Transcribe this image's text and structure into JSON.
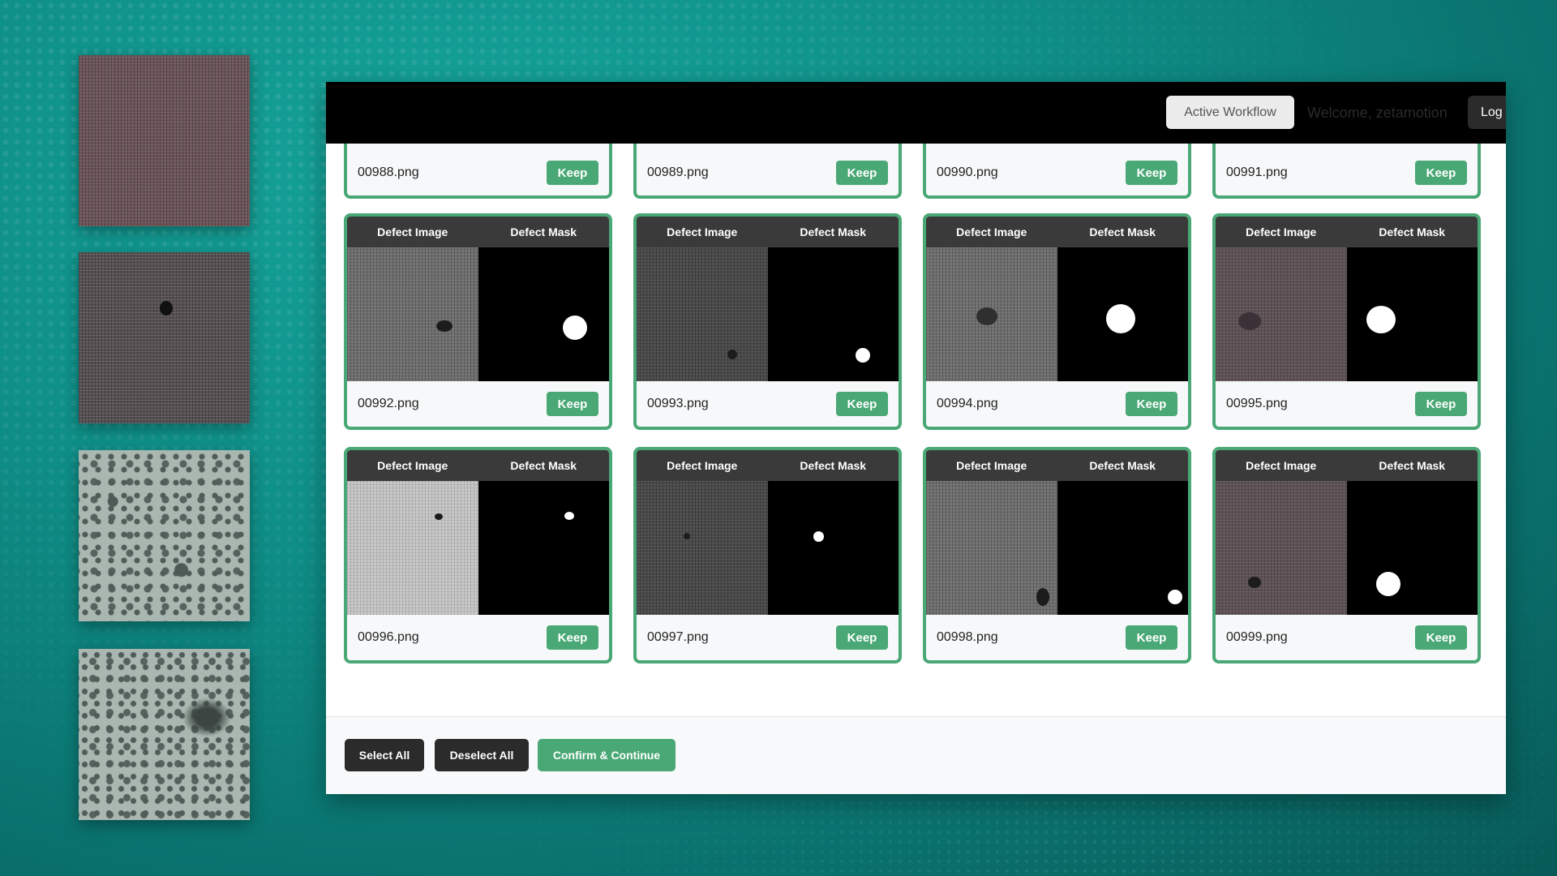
{
  "header": {
    "active_workflow_label": "Active Workflow",
    "welcome_text": "Welcome, zetamotion",
    "logout_label": "Log"
  },
  "card_labels": {
    "defect_image": "Defect Image",
    "defect_mask": "Defect Mask",
    "keep": "Keep"
  },
  "top_row_files": [
    "00988.png",
    "00989.png",
    "00990.png",
    "00991.png"
  ],
  "cards": [
    {
      "filename": "00992.png"
    },
    {
      "filename": "00993.png"
    },
    {
      "filename": "00994.png"
    },
    {
      "filename": "00995.png"
    },
    {
      "filename": "00996.png"
    },
    {
      "filename": "00997.png"
    },
    {
      "filename": "00998.png"
    },
    {
      "filename": "00999.png"
    }
  ],
  "footer": {
    "select_all": "Select All",
    "deselect_all": "Deselect All",
    "confirm_continue": "Confirm & Continue"
  },
  "colors": {
    "accent_green": "#4aa876",
    "background_teal": "#0e8d86",
    "topbar": "#000000"
  }
}
